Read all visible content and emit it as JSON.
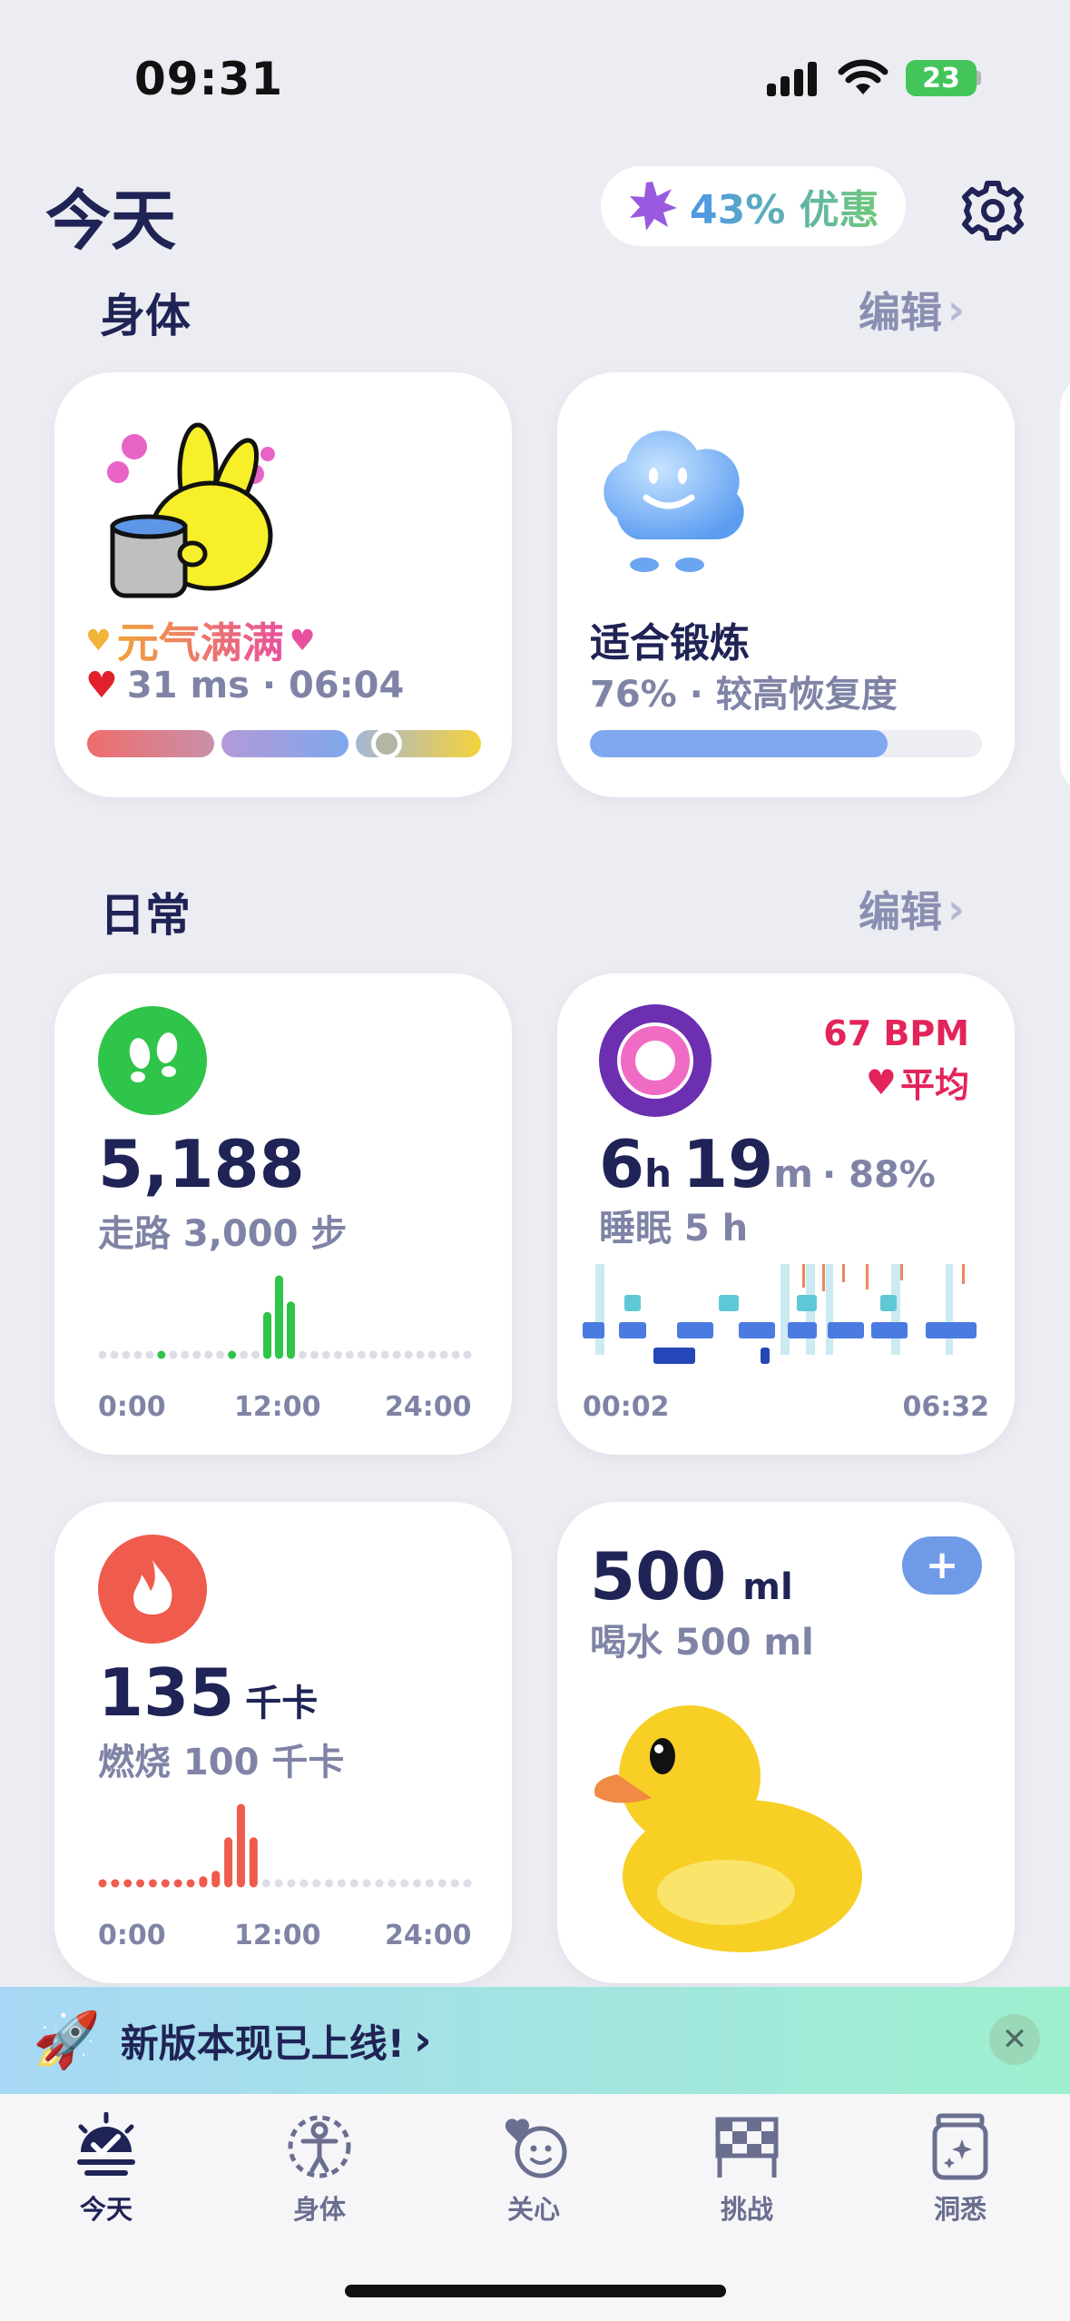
{
  "status_bar": {
    "time": "09:31",
    "battery": "23"
  },
  "header": {
    "title": "今天",
    "promo": "43% 优惠"
  },
  "body_section": {
    "title": "身体",
    "edit": "编辑",
    "energy_card": {
      "title": "元气满满",
      "metric": "31 ms · 06:04"
    },
    "recovery_card": {
      "title": "适合锻炼",
      "subtitle": "76% · 较高恢复度",
      "progress": 0.76
    }
  },
  "daily_section": {
    "title": "日常",
    "edit": "编辑",
    "steps_card": {
      "value": "5,188",
      "goal": "走路 3,000 步",
      "axis": [
        "0:00",
        "12:00",
        "24:00"
      ],
      "chart_data": {
        "type": "bar",
        "x_label_start": "0:00",
        "values": [
          0,
          0,
          0,
          0,
          0,
          1,
          0,
          0,
          0,
          0,
          0,
          1,
          0,
          0,
          9,
          16,
          11,
          0,
          0,
          0,
          0,
          0,
          0,
          0,
          0,
          0,
          0,
          0,
          0,
          0,
          0,
          0
        ]
      }
    },
    "sleep_card": {
      "bpm": "67 BPM",
      "bpm_label": "平均",
      "hours": "6",
      "hours_unit": "h",
      "minutes": "19",
      "minutes_unit": "m",
      "percent": "· 88%",
      "goal": "睡眠 5 h",
      "axis_start": "00:02",
      "axis_end": "06:32"
    },
    "calorie_card": {
      "value": "135",
      "unit": "千卡",
      "goal": "燃烧 100 千卡",
      "axis": [
        "0:00",
        "12:00",
        "24:00"
      ],
      "chart_data": {
        "type": "bar",
        "values": [
          1,
          1,
          1,
          1,
          1,
          1,
          1,
          1,
          2,
          3,
          9,
          15,
          9,
          0,
          0,
          0,
          0,
          0,
          0,
          0,
          0,
          0,
          0,
          0,
          0,
          0,
          0,
          0,
          0,
          0
        ]
      }
    },
    "water_card": {
      "value": "500",
      "unit": "ml",
      "goal": "喝水 500 ml"
    }
  },
  "banner": {
    "text": "新版本现已上线!"
  },
  "tabs": [
    {
      "label": "今天",
      "icon": "today-icon"
    },
    {
      "label": "身体",
      "icon": "body-icon"
    },
    {
      "label": "关心",
      "icon": "care-icon"
    },
    {
      "label": "挑战",
      "icon": "challenge-icon"
    },
    {
      "label": "洞悉",
      "icon": "insight-icon"
    }
  ],
  "colors": {
    "navy": "#1f2355",
    "green": "#2fc44a",
    "red": "#ef5b4c",
    "purple": "#6c2fb0",
    "pink": "#e3245a",
    "blue": "#7fa8f0"
  }
}
